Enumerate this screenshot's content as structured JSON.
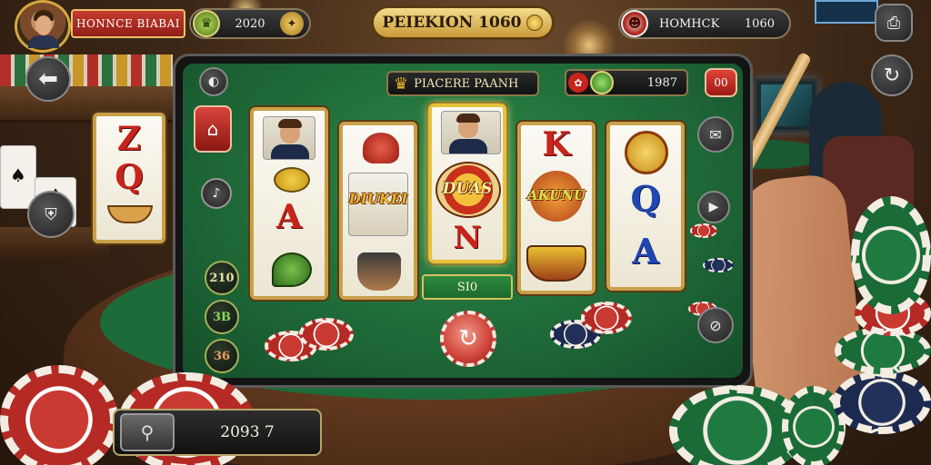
{
  "hud": {
    "player_name": "HONNCE BIABAI",
    "balance_value": "2020",
    "game_title": "PEIEKION 1060",
    "opponent_name": "HOMHCK",
    "opponent_value": "1060"
  },
  "tablet": {
    "header_title": "PIACERE PAANH",
    "header_value": "1987",
    "menu_label": "00"
  },
  "reels": [
    {
      "id": "reel-1",
      "symbols": [
        "portrait-cards",
        "speech-bubble",
        "A",
        "leaf"
      ]
    },
    {
      "id": "reel-2",
      "symbols": [
        "red-helmet",
        "DIUKEI",
        "lamp-man"
      ]
    },
    {
      "id": "reel-3",
      "symbols": [
        "portrait-hat",
        "DUAS",
        "N"
      ]
    },
    {
      "id": "reel-4",
      "symbols": [
        "K",
        "AKUNU",
        "fruit-basket"
      ]
    },
    {
      "id": "reel-5",
      "symbols": [
        "gold-medal",
        "Q",
        "A"
      ]
    }
  ],
  "side_reel": {
    "letters": [
      "Z",
      "Q"
    ]
  },
  "bet": {
    "label": "SI0"
  },
  "left_buttons": [
    {
      "label": "210"
    },
    {
      "label": "3B"
    },
    {
      "label": "36"
    }
  ],
  "bottom_bar": {
    "value": "2093 7"
  },
  "colors": {
    "felt": "#1f6b38",
    "gold_border": "#c9a04a",
    "chip_red": "#c93a33",
    "chip_green": "#1f7a40",
    "title_gold": "#e8c45a"
  },
  "icons": {
    "back": "arrow-left-icon",
    "trophy": "trophy-icon",
    "shield": "shield-icon",
    "settings": "refresh-icon",
    "share": "share-icon",
    "play": "play-icon",
    "chat": "chat-icon"
  }
}
